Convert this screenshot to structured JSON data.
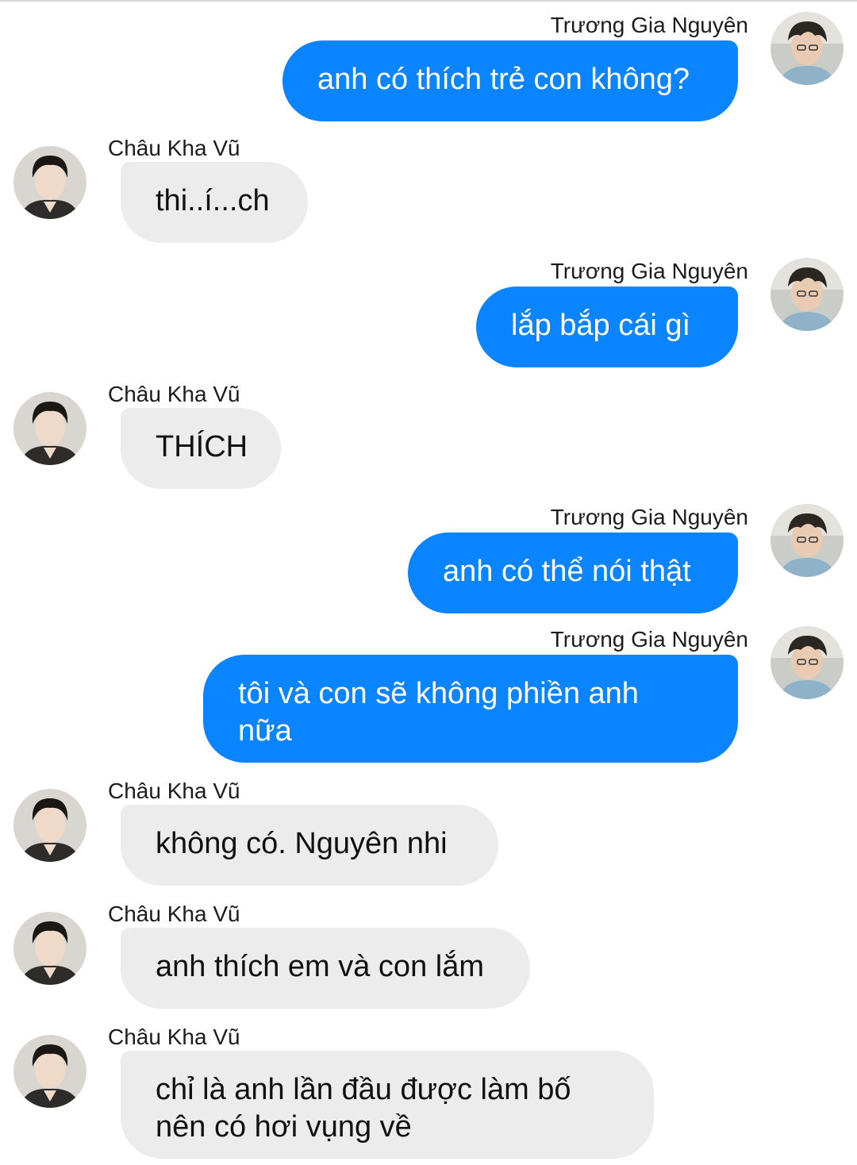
{
  "theme": {
    "outgoing_bubble": "#0a84ff",
    "incoming_bubble": "#ececec",
    "outgoing_text": "#ffffff",
    "incoming_text": "#111111"
  },
  "contacts": {
    "me": {
      "name": "Trương Gia Nguyên",
      "avatar_icon": "avatar-photo-icon"
    },
    "other": {
      "name": "Châu Kha Vũ",
      "avatar_icon": "avatar-photo-icon"
    }
  },
  "messages": [
    {
      "sender": "Trương Gia Nguyên",
      "direction": "outgoing",
      "text": "anh có thích trẻ con không?"
    },
    {
      "sender": "Châu Kha Vũ",
      "direction": "incoming",
      "text": "thi..í...ch"
    },
    {
      "sender": "Trương Gia Nguyên",
      "direction": "outgoing",
      "text": "lắp bắp cái gì"
    },
    {
      "sender": "Châu Kha Vũ",
      "direction": "incoming",
      "text": "THÍCH"
    },
    {
      "sender": "Trương Gia Nguyên",
      "direction": "outgoing",
      "text": "anh có thể nói thật"
    },
    {
      "sender": "Trương Gia Nguyên",
      "direction": "outgoing",
      "text": "tôi và con sẽ không phiền anh nữa"
    },
    {
      "sender": "Châu Kha Vũ",
      "direction": "incoming",
      "text": "không có. Nguyên nhi"
    },
    {
      "sender": "Châu Kha Vũ",
      "direction": "incoming",
      "text": "anh thích em và con lắm"
    },
    {
      "sender": "Châu Kha Vũ",
      "direction": "incoming",
      "text": "chỉ là anh lần đầu được làm bố nên có hơi vụng về"
    }
  ]
}
